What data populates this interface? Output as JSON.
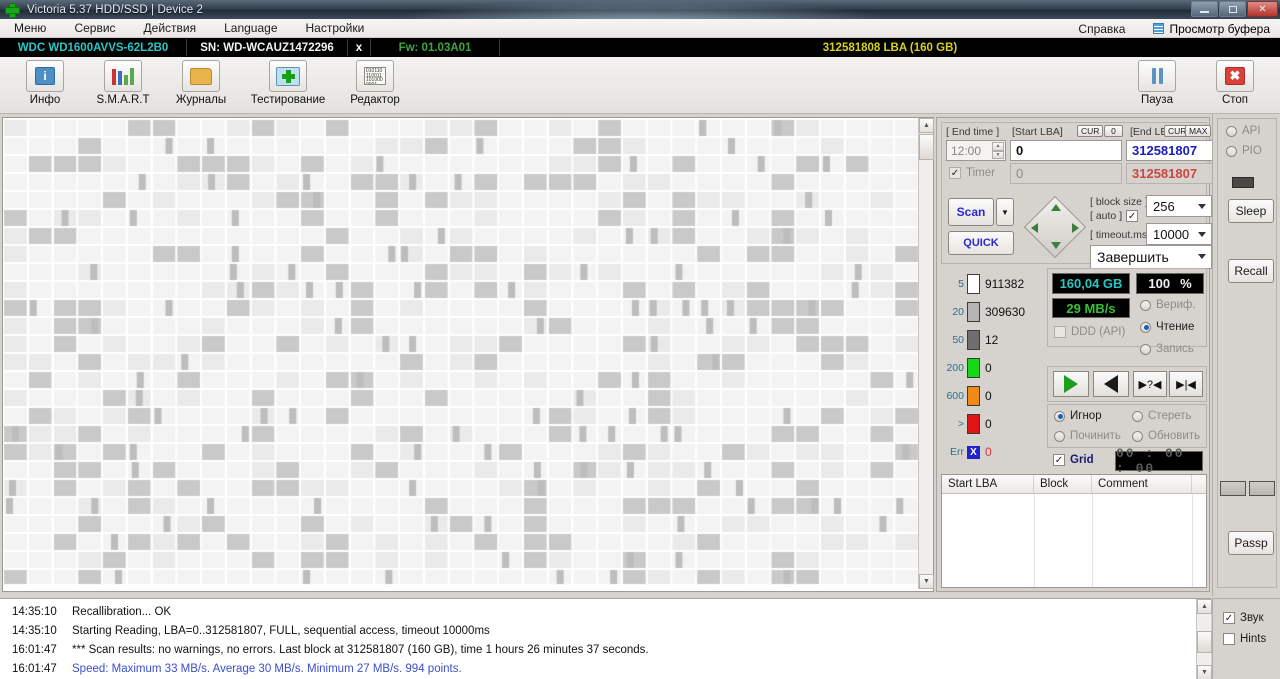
{
  "window": {
    "title": "Victoria 5.37 HDD/SSD | Device 2",
    "app_icon": "green-cross-icon",
    "minimize_label": "",
    "maximize_label": "",
    "close_label": "✕"
  },
  "menubar": {
    "items": [
      {
        "label": "Меню"
      },
      {
        "label": "Сервис"
      },
      {
        "label": "Действия"
      },
      {
        "label": "Language"
      },
      {
        "label": "Настройки"
      }
    ],
    "help_label": "Справка",
    "buffer_label": "Просмотр буфера"
  },
  "device": {
    "model": "WDC WD1600AVVS-62L2B0",
    "serial": "SN: WD-WCAUZ1472296",
    "close_mark": "x",
    "firmware": "Fw: 01.03A01",
    "capacity": "312581808 LBA (160 GB)"
  },
  "toolbar": {
    "items": [
      {
        "label": "Инфо",
        "icon": "info-icon"
      },
      {
        "label": "S.M.A.R.T",
        "icon": "smart-chart-icon"
      },
      {
        "label": "Журналы",
        "icon": "folder-icon"
      },
      {
        "label": "Тестирование",
        "icon": "test-plus-icon"
      },
      {
        "label": "Редактор",
        "icon": "binary-editor-icon"
      }
    ],
    "pause_label": "Пауза",
    "stop_label": "Стоп"
  },
  "scan_params": {
    "end_time_label": "[ End time ]",
    "end_time_value": "12:00",
    "start_lba_label": "[Start LBA]",
    "start_lba_cur": "CUR",
    "start_lba_zero": "0",
    "start_lba_value": "0",
    "end_lba_label": "[End LBA]",
    "end_lba_cur": "CUR",
    "end_lba_max": "MAX",
    "end_lba_value": "312581807",
    "timer_label": "Timer",
    "timer_value": "0",
    "pass_end_value": "312581807",
    "scan_label": "Scan",
    "quick_label": "QUICK",
    "block_size_label": "[ block size ]",
    "auto_label": "[ auto ]",
    "block_size_value": "256",
    "timeout_label": "[ timeout.ms ]",
    "timeout_value": "10000",
    "on_finish_value": "Завершить"
  },
  "legend": {
    "rows": [
      {
        "ms": "5",
        "count": "911382",
        "color": "#ffffff"
      },
      {
        "ms": "20",
        "count": "309630",
        "color": "#b5b5b5"
      },
      {
        "ms": "50",
        "count": "12",
        "color": "#6e6e6e"
      },
      {
        "ms": "200",
        "count": "0",
        "color": "#16d916"
      },
      {
        "ms": "600",
        "count": "0",
        "color": "#f08a16"
      },
      {
        "ms": ">",
        "count": "0",
        "color": "#e01414"
      },
      {
        "ms": "Err",
        "count": "0",
        "color": "#2222cc"
      }
    ]
  },
  "readouts": {
    "size_value": "160,04 GB",
    "percent_value": "100",
    "percent_unit": "%",
    "speed_value": "29 MB/s",
    "ddd_label": "DDD (API)",
    "timer_value": "00 : 00 : 00",
    "grid_label": "Grid"
  },
  "modes": {
    "verify_label": "Вериф.",
    "read_label": "Чтение",
    "write_label": "Запись",
    "selected": "Чтение"
  },
  "actions": {
    "ignore_label": "Игнор",
    "erase_label": "Стереть",
    "repair_label": "Починить",
    "refresh_label": "Обновить",
    "selected": "Игнор"
  },
  "nav_buttons": {
    "play_label": "play-icon",
    "back_label": "back-icon",
    "skip_query_label": "▶?◀",
    "skip_end_label": "▶|◀"
  },
  "defect_table": {
    "columns": [
      "Start LBA",
      "Block",
      "Comment"
    ],
    "rows": []
  },
  "sidebar": {
    "api_label": "API",
    "pio_label": "PIO",
    "sleep_label": "Sleep",
    "recall_label": "Recall",
    "passp_label": "Passp",
    "sound_label": "Звук",
    "hints_label": "Hints"
  },
  "log": {
    "entries": [
      {
        "time": "14:35:10",
        "message": "Recallibration... OK",
        "color": "#111111"
      },
      {
        "time": "14:35:10",
        "message": "Starting Reading, LBA=0..312581807, FULL, sequential access, timeout 10000ms",
        "color": "#111111"
      },
      {
        "time": "16:01:47",
        "message": "*** Scan results: no warnings, no errors. Last block at 312581807 (160 GB), time 1 hours 26 minutes 37 seconds.",
        "color": "#111111"
      },
      {
        "time": "16:01:47",
        "message": "Speed: Maximum 33 MB/s. Average 30 MB/s. Minimum 27 MB/s. 994 points.",
        "color": "#3b4fc9"
      }
    ]
  }
}
